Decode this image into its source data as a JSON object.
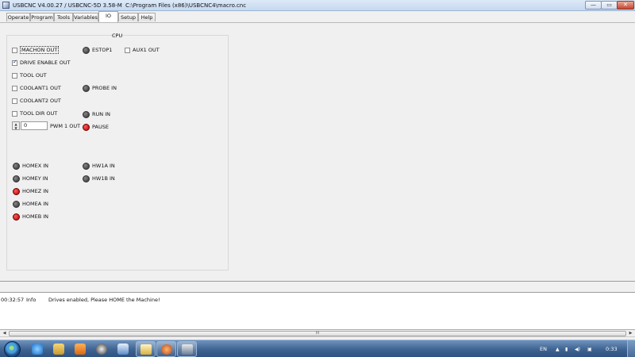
{
  "window": {
    "title": "USBCNC V4.00.27 / USBCNC-5D 3.58-M",
    "path": "C:\\Program Files (x86)\\USBCNC4\\macro.cnc",
    "min_glyph": "—",
    "max_glyph": "▭",
    "close_glyph": "✕"
  },
  "tabs": [
    {
      "label": "Operate"
    },
    {
      "label": "Program"
    },
    {
      "label": "Tools"
    },
    {
      "label": "Variables"
    },
    {
      "label": "IO"
    },
    {
      "label": "Setup"
    },
    {
      "label": "Help"
    }
  ],
  "active_tab": "IO",
  "cpu": {
    "title": "CPU",
    "outputs": [
      {
        "label": "MACHON OUT",
        "checked": false
      },
      {
        "label": "DRIVE ENABLE OUT",
        "checked": true
      },
      {
        "label": "TOOL OUT",
        "checked": false
      },
      {
        "label": "COOLANT1 OUT",
        "checked": false
      },
      {
        "label": "COOLANT2 OUT",
        "checked": false
      },
      {
        "label": "TOOL DIR OUT",
        "checked": false
      }
    ],
    "aux": {
      "label": "AUX1 OUT",
      "checked": false
    },
    "pwm": {
      "value": "0",
      "label": "PWM 1 OUT"
    },
    "leds_mid": [
      {
        "label": "ESTOP1",
        "state": "off"
      },
      {
        "label": "PROBE IN",
        "state": "off"
      },
      {
        "label": "RUN IN",
        "state": "off"
      },
      {
        "label": "PAUSE",
        "state": "on"
      }
    ],
    "homes": [
      {
        "label": "HOMEX IN",
        "state": "off"
      },
      {
        "label": "HOMEY IN",
        "state": "off"
      },
      {
        "label": "HOMEZ IN",
        "state": "on"
      },
      {
        "label": "HOMEA IN",
        "state": "off"
      },
      {
        "label": "HOMEB IN",
        "state": "on"
      }
    ],
    "hw": [
      {
        "label": "HW1A IN",
        "state": "off"
      },
      {
        "label": "HW1B IN",
        "state": "off"
      }
    ]
  },
  "log": {
    "time": "00:32:57",
    "level": "Info",
    "message": "Drives enabled, Please HOME the Machine!",
    "scroll_left_glyph": "◀",
    "scroll_right_glyph": "▶",
    "scroll_grip": "III"
  },
  "taskbar": {
    "language": "EN",
    "clock": "0:33",
    "tray_up_glyph": "▲"
  },
  "colors": {
    "led_off": "#3a3a3a",
    "led_on": "#d40000",
    "taskbar": "#3f6491"
  }
}
